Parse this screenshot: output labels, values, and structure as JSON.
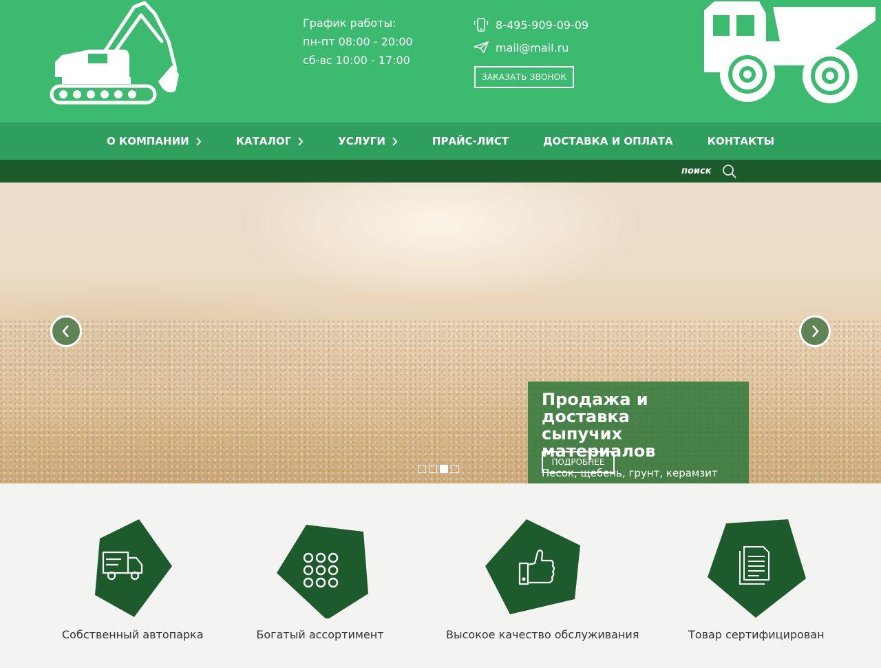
{
  "header": {
    "schedule_title": "График работы:",
    "schedule_weekdays": "пн-пт 08:00 - 20:00",
    "schedule_weekend": "сб-вс 10:00 - 17:00",
    "phone": "8-495-909-09-09",
    "email": "mail@mail.ru",
    "callback_label": "ЗАКАЗАТЬ ЗВОНОК"
  },
  "nav": {
    "items": [
      {
        "label": "О КОМПАНИИ",
        "has_submenu": true
      },
      {
        "label": "КАТАЛОГ",
        "has_submenu": true
      },
      {
        "label": "УСЛУГИ",
        "has_submenu": true
      },
      {
        "label": "ПРАЙС-ЛИСТ",
        "has_submenu": false
      },
      {
        "label": "ДОСТАВКА И ОПЛАТА",
        "has_submenu": false
      },
      {
        "label": "КОНТАКТЫ",
        "has_submenu": false
      }
    ]
  },
  "search": {
    "label": "поиск",
    "icon": "search-icon"
  },
  "slider": {
    "title_line1": "Продажа и доставка",
    "title_line2": "сыпучих материалов",
    "subtitle": "Песок, щебень, грунт,  керамзит",
    "more_label": "ПОДРОБНЕЕ",
    "dots": 4,
    "active_dot": 3
  },
  "features": [
    {
      "label": "Собственный автопарка",
      "icon": "truck-icon"
    },
    {
      "label": "Богатый ассортимент",
      "icon": "grid-icon"
    },
    {
      "label": "Высокое качество обслуживания",
      "icon": "thumbs-up-icon"
    },
    {
      "label": "Товар сертифицирован",
      "icon": "document-icon"
    }
  ],
  "colors": {
    "header_green": "#3cbb70",
    "nav_green": "#2f9f5d",
    "dark_green": "#1d5b2c"
  }
}
